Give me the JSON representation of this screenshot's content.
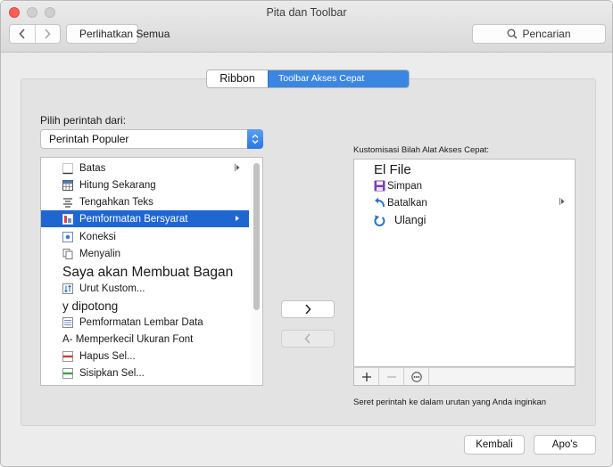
{
  "window": {
    "title": "Pita dan Toolbar"
  },
  "toolbar": {
    "show_all_label": "Perlihatkan Semua",
    "search_label": "Pencarian"
  },
  "tabs": [
    {
      "label": "Ribbon"
    },
    {
      "label": "Toolbar Akses Cepat"
    }
  ],
  "left": {
    "choose_label": "Pilih perintah dari:",
    "select_value": "Perintah Populer",
    "commands": [
      {
        "label": "Batas"
      },
      {
        "label": "Hitung Sekarang"
      },
      {
        "label": "Tengahkan Teks"
      },
      {
        "label": "Pemformatan Bersyarat"
      },
      {
        "label": "Koneksi"
      },
      {
        "label": "Menyalin"
      },
      {
        "label": "Saya akan Membuat Bagan"
      },
      {
        "label": "Urut Kustom..."
      },
      {
        "label": "y dipotong"
      },
      {
        "label": "Pemformatan Lembar Data"
      },
      {
        "label": "A- Memperkecil Ukuran Font"
      },
      {
        "label": "Hapus Sel..."
      },
      {
        "label": "Sisipkan Sel..."
      }
    ]
  },
  "right": {
    "customize_label": "Kustomisasi Bilah Alat Akses Cepat:",
    "items": [
      {
        "label": "El File"
      },
      {
        "label": "Simpan"
      },
      {
        "label": "Batalkan"
      },
      {
        "label": "Ulangi"
      }
    ],
    "hint": "Seret perintah ke dalam urutan yang Anda inginkan"
  },
  "footer": {
    "reset_label": "Kembali",
    "apps_label": "Apo's"
  },
  "colors": {
    "accent": "#1f66d1",
    "tab_active": "#3b86e0",
    "close": "#fc5f57"
  },
  "icons": {
    "back": "chevron-left-icon",
    "forward": "chevron-right-icon",
    "search": "magnifier-icon",
    "add": "plus-icon",
    "remove": "minus-icon",
    "more": "ellipsis-icon"
  }
}
